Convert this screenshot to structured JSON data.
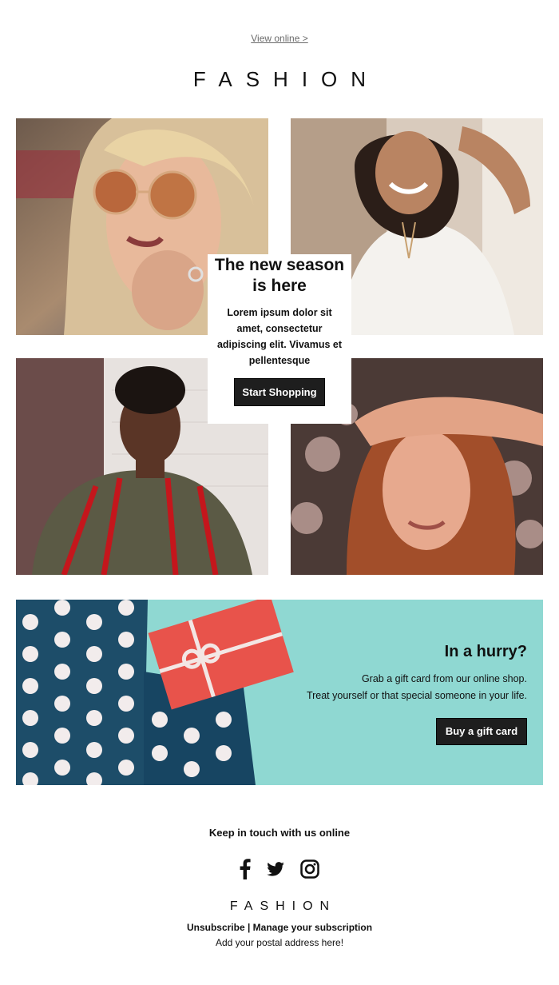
{
  "header": {
    "view_online": "View online >",
    "brand": "FASHION"
  },
  "photos": [
    {
      "icon": "woman-sunglasses-photo"
    },
    {
      "icon": "woman-white-shirt-photo"
    },
    {
      "icon": "woman-striped-jacket-photo"
    },
    {
      "icon": "woman-red-hair-photo"
    }
  ],
  "hero_card": {
    "title": "The new season is here",
    "body": "Lorem ipsum dolor sit amet, consectetur adipiscing elit. Vivamus et pellentesque",
    "button_label": "Start Shopping"
  },
  "gift_banner": {
    "title": "In a hurry?",
    "line1": "Grab a gift card from our online shop.",
    "line2": "Treat yourself or that special someone in your life.",
    "button_label": "Buy a gift card",
    "colors": {
      "background": "#8fd8d2",
      "polka": "#1d4d69",
      "card": "#e8534b"
    }
  },
  "footer": {
    "keep_in_touch": "Keep in touch with us online",
    "social": [
      "facebook-icon",
      "twitter-icon",
      "instagram-icon"
    ],
    "brand": "FASHION",
    "unsubscribe": "Unsubscribe",
    "separator": " | ",
    "manage": "Manage your subscription",
    "postal": "Add your postal address here!"
  }
}
